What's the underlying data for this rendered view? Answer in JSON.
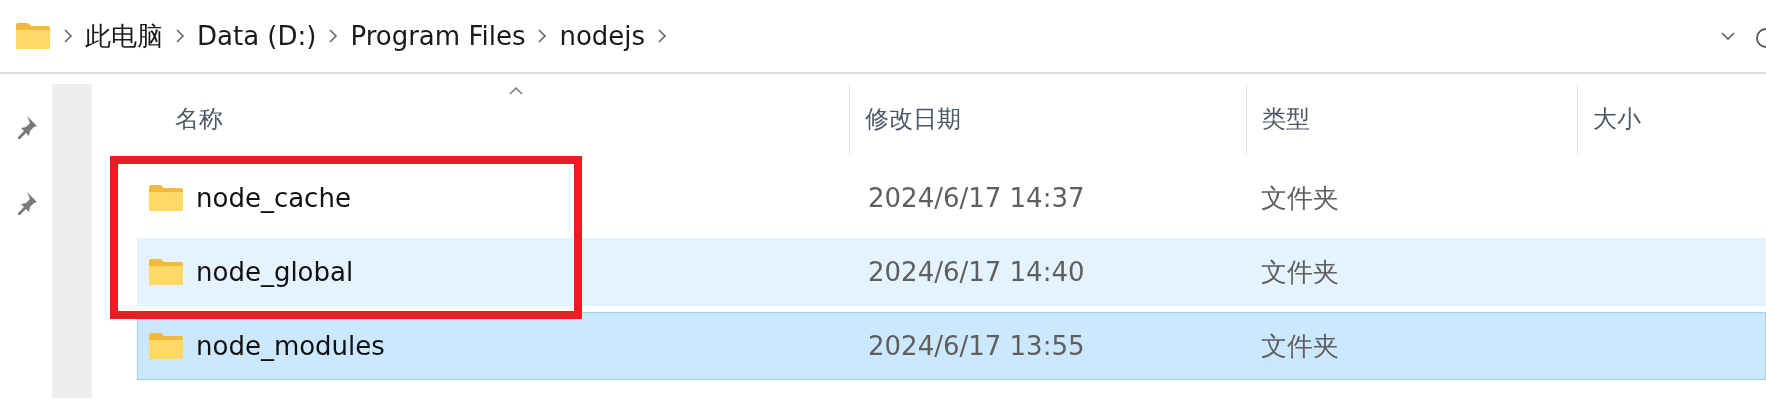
{
  "breadcrumb": [
    "此电脑",
    "Data (D:)",
    "Program Files",
    "nodejs"
  ],
  "columns": [
    {
      "label": "名称",
      "sorted": true
    },
    {
      "label": "修改日期",
      "sorted": false
    },
    {
      "label": "类型",
      "sorted": false
    },
    {
      "label": "大小",
      "sorted": false
    }
  ],
  "rows": [
    {
      "name": "node_cache",
      "modified": "2024/6/17 14:37",
      "type": "文件夹",
      "hovered": false,
      "selected": false,
      "annotated": true
    },
    {
      "name": "node_global",
      "modified": "2024/6/17 14:40",
      "type": "文件夹",
      "hovered": true,
      "selected": false,
      "annotated": true
    },
    {
      "name": "node_modules",
      "modified": "2024/6/17 13:55",
      "type": "文件夹",
      "hovered": false,
      "selected": true,
      "annotated": false
    }
  ]
}
